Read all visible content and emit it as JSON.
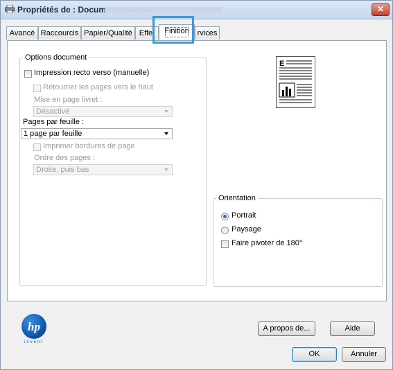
{
  "window": {
    "title": "Propriétés de : Document",
    "close_label": "✕"
  },
  "tabs": [
    {
      "label": "Avancé"
    },
    {
      "label": "Raccourcis"
    },
    {
      "label": "Papier/Qualité"
    },
    {
      "label": "Effet"
    },
    {
      "label": "Finition"
    },
    {
      "label": "rvices"
    }
  ],
  "options_document": {
    "legend": "Options document",
    "duplex_label": "Impression recto verso (manuelle)",
    "flip_label": "Retourner les pages vers le haut",
    "booklet_label": "Mise en page livret :",
    "booklet_value": "Désactivé",
    "pages_per_sheet_label": "Pages par feuille :",
    "pages_per_sheet_value": "1 page par feuille",
    "borders_label": "Imprimer bordures de page",
    "order_label": "Ordre des pages :",
    "order_value": "Droite, puis bas"
  },
  "orientation": {
    "legend": "Orientation",
    "portrait_label": "Portrait",
    "landscape_label": "Paysage",
    "rotate_label": "Faire pivoter de 180°",
    "selected": "Portrait"
  },
  "preview": {
    "letter": "E"
  },
  "logo": {
    "text": "invent",
    "mark": "hp"
  },
  "buttons": {
    "about": "A propos de...",
    "help": "Aide",
    "ok": "OK",
    "cancel": "Annuler"
  }
}
